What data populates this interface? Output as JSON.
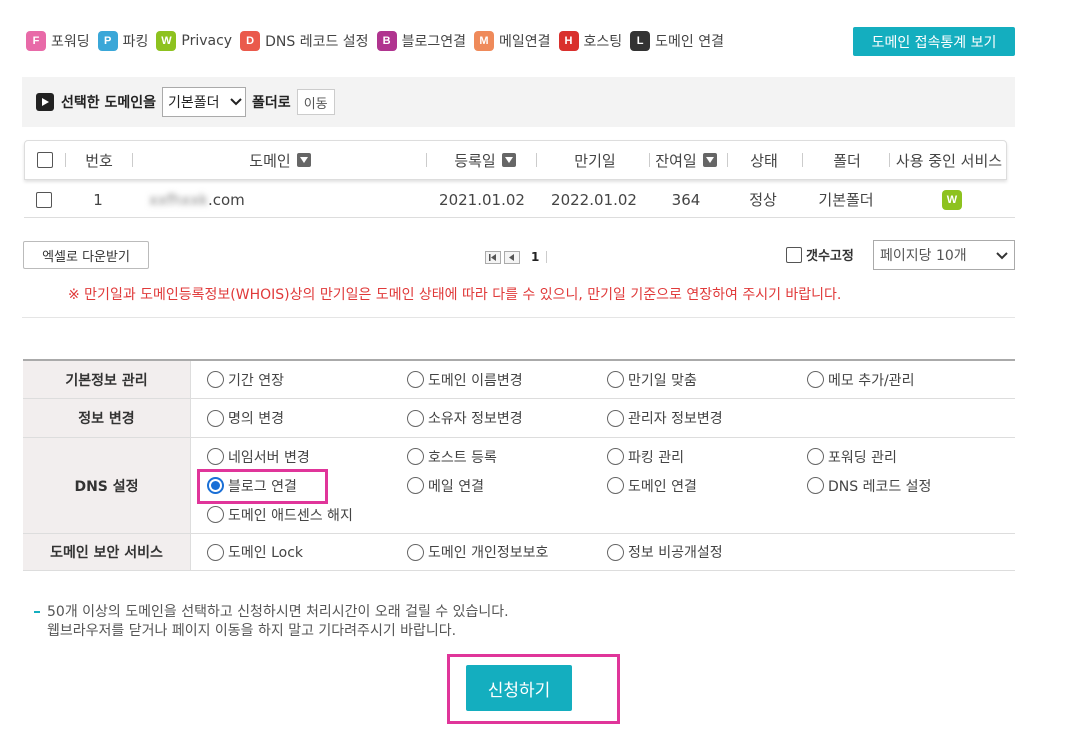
{
  "legend": [
    {
      "badge": "F",
      "label": "포워딩",
      "color": "#e86aa8"
    },
    {
      "badge": "P",
      "label": "파킹",
      "color": "#3aa7d8"
    },
    {
      "badge": "W",
      "label": "Privacy",
      "color": "#8dc21f"
    },
    {
      "badge": "D",
      "label": "DNS 레코드 설정",
      "color": "#ea5a4c"
    },
    {
      "badge": "B",
      "label": "블로그연결",
      "color": "#b0348f"
    },
    {
      "badge": "M",
      "label": "메일연결",
      "color": "#ef8a5a"
    },
    {
      "badge": "H",
      "label": "호스팅",
      "color": "#d9302d"
    },
    {
      "badge": "L",
      "label": "도메인 연결",
      "color": "#333333"
    }
  ],
  "stats_button": "도메인 접속통계 보기",
  "move_bar": {
    "label": "선택한 도메인을",
    "folder": "기본폴더",
    "suffix": "폴더로",
    "button": "이동"
  },
  "table": {
    "headers": {
      "number": "번호",
      "domain": "도메인",
      "registered": "등록일",
      "expiry": "만기일",
      "remaining": "잔여일",
      "status": "상태",
      "folder": "폴더",
      "services": "사용 중인 서비스"
    },
    "rows": [
      {
        "number": "1",
        "domain_blurred": "xxfhxxk",
        "domain_tld": ".com",
        "registered": "2021.01.02",
        "expiry": "2022.01.02",
        "remaining": "364",
        "status": "정상",
        "folder": "기본폴더",
        "service_badge": "W"
      }
    ]
  },
  "excel_button": "엑셀로 다운받기",
  "pager": {
    "current": "1"
  },
  "count_fix_label": "갯수고정",
  "per_page": "페이지당 10개",
  "notice": "※ 만기일과 도메인등록정보(WHOIS)상의 만기일은 도메인 상태에 따라 다를 수 있으니, 만기일 기준으로 연장하여 주시기 바랍니다.",
  "services": [
    {
      "label": "기본정보 관리",
      "options": [
        "기간 연장",
        "도메인 이름변경",
        "만기일 맞춤",
        "메모 추가/관리"
      ]
    },
    {
      "label": "정보 변경",
      "options": [
        "명의 변경",
        "소유자 정보변경",
        "관리자 정보변경"
      ]
    },
    {
      "label": "DNS 설정",
      "options": [
        "네임서버 변경",
        "호스트 등록",
        "파킹 관리",
        "포워딩 관리",
        "블로그 연결",
        "메일 연결",
        "도메인 연결",
        "DNS 레코드 설정",
        "도메인 애드센스 해지"
      ]
    },
    {
      "label": "도메인 보안 서비스",
      "options": [
        "도메인 Lock",
        "도메인 개인정보보호",
        "정보 비공개설정"
      ]
    }
  ],
  "selected_service": "블로그 연결",
  "info_lines": [
    "50개 이상의 도메인을 선택하고 신청하시면 처리시간이 오래 걸릴 수 있습니다.",
    "웹브라우저를 닫거나 페이지 이동을 하지 말고 기다려주시기 바랍니다."
  ],
  "apply_button": "신청하기"
}
